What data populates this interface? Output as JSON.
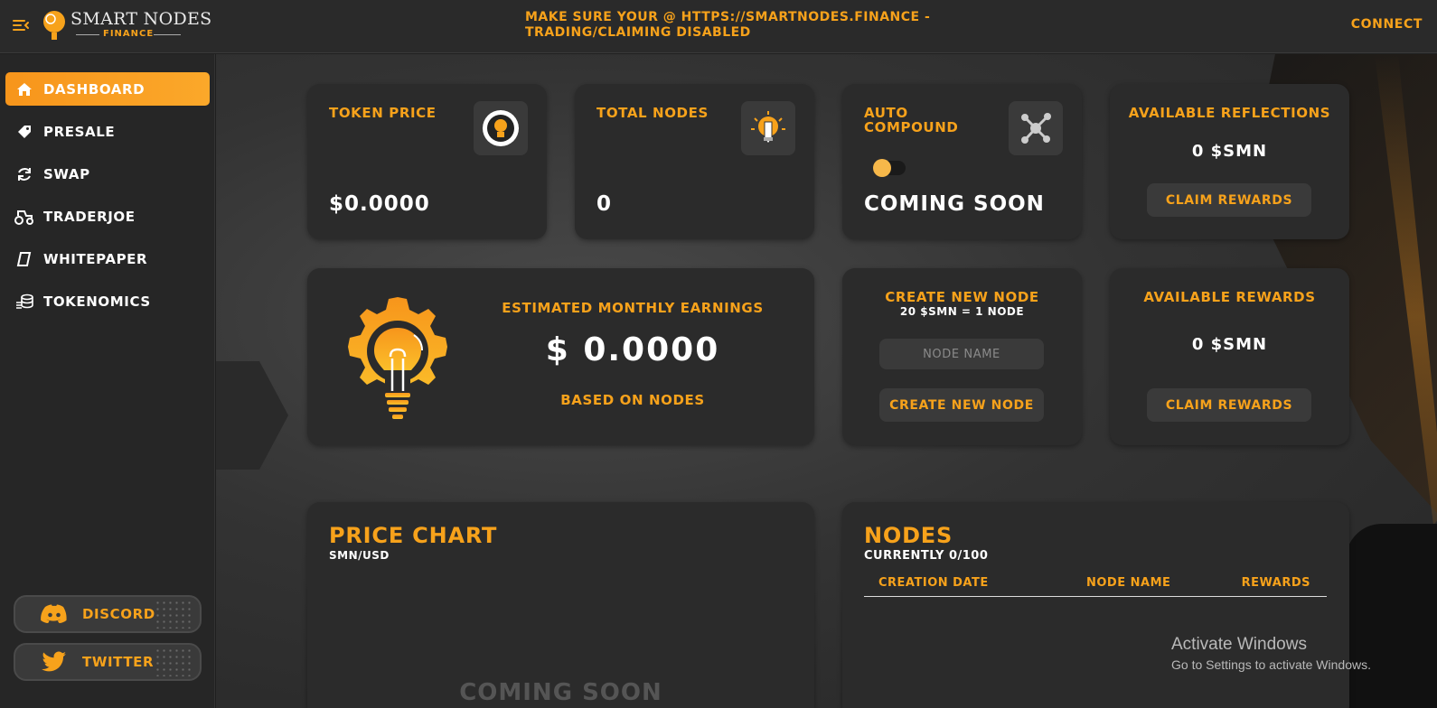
{
  "header": {
    "logo_line1": "SMART NODES",
    "logo_line2": "FINANCE",
    "announcement_line1": "MAKE SURE YOUR @ HTTPS://SMARTNODES.FINANCE -",
    "announcement_line2": "TRADING/CLAIMING DISABLED",
    "connect_label": "CONNECT"
  },
  "sidebar": {
    "items": [
      {
        "label": "DASHBOARD",
        "icon": "home-icon",
        "active": true
      },
      {
        "label": "PRESALE",
        "icon": "tag-icon",
        "active": false
      },
      {
        "label": "SWAP",
        "icon": "refresh-icon",
        "active": false
      },
      {
        "label": "TRADERJOE",
        "icon": "tractor-icon",
        "active": false
      },
      {
        "label": "WHITEPAPER",
        "icon": "paper-icon",
        "active": false
      },
      {
        "label": "TOKENOMICS",
        "icon": "coins-icon",
        "active": false
      }
    ],
    "discord_label": "DISCORD",
    "twitter_label": "TWITTER"
  },
  "cards": {
    "token_price": {
      "title": "TOKEN PRICE",
      "value": "$0.0000",
      "icon": "bulb-gear-icon"
    },
    "total_nodes": {
      "title": "TOTAL NODES",
      "value": "0",
      "icon": "bulb-pencil-icon"
    },
    "auto_compound": {
      "title_line1": "AUTO",
      "title_line2": "COMPOUND",
      "value": "COMING SOON",
      "icon": "network-icon",
      "toggle_on": false
    },
    "available_reflections": {
      "title": "AVAILABLE REFLECTIONS",
      "value": "0 $SMN",
      "button": "CLAIM REWARDS"
    },
    "monthly_earnings": {
      "title": "ESTIMATED MONTHLY EARNINGS",
      "value": "$ 0.0000",
      "subtitle": "BASED ON NODES",
      "icon": "bulb-gear-large-icon"
    },
    "create_node": {
      "title": "CREATE NEW NODE",
      "subtitle": "20 $SMN = 1 NODE",
      "placeholder": "NODE NAME",
      "button": "CREATE NEW NODE"
    },
    "available_rewards": {
      "title": "AVAILABLE REWARDS",
      "value": "0 $SMN",
      "button": "CLAIM REWARDS"
    },
    "price_chart": {
      "title": "PRICE CHART",
      "pair": "SMN/USD",
      "placeholder": "COMING SOON"
    },
    "nodes": {
      "title": "NODES",
      "subtitle": "CURRENTLY 0/100",
      "columns": [
        "CREATION DATE",
        "NODE NAME",
        "REWARDS"
      ]
    }
  },
  "watermark": {
    "line1": "Activate Windows",
    "line2": "Go to Settings to activate Windows."
  },
  "colors": {
    "accent": "#f7a21b",
    "card": "#2b2b2b",
    "sidebar": "#262626"
  }
}
